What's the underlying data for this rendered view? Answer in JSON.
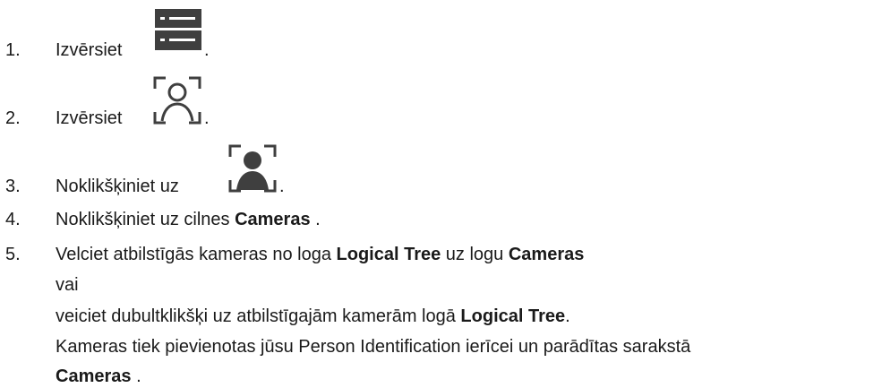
{
  "steps": [
    {
      "num": "1.",
      "text": "Izvērsiet",
      "suffix": ".",
      "icon": "server-list-icon"
    },
    {
      "num": "2.",
      "text": "Izvērsiet",
      "suffix": ".",
      "icon": "person-frame-outline-icon"
    },
    {
      "num": "3.",
      "text": "Noklikšķiniet uz",
      "suffix": ".",
      "icon": "person-frame-filled-icon"
    },
    {
      "num": "4.",
      "text_before": "Noklikšķiniet uz cilnes",
      "bold": "Cameras",
      "text_after": "."
    },
    {
      "num": "5.",
      "line1_before": "Velciet atbilstīgās kameras no loga",
      "line1_bold1": "Logical Tree",
      "line1_mid": "uz logu",
      "line1_bold2": "Cameras",
      "line2": "vai",
      "line3_before": "veiciet dubultklikšķi uz atbilstīgajām kamerām logā",
      "line3_bold": "Logical Tree",
      "line3_after": ".",
      "line4": "Kameras tiek pievienotas jūsu Person Identification ierīcei un parādītas sarakstā",
      "line5_bold": "Cameras",
      "line5_after": "."
    }
  ]
}
